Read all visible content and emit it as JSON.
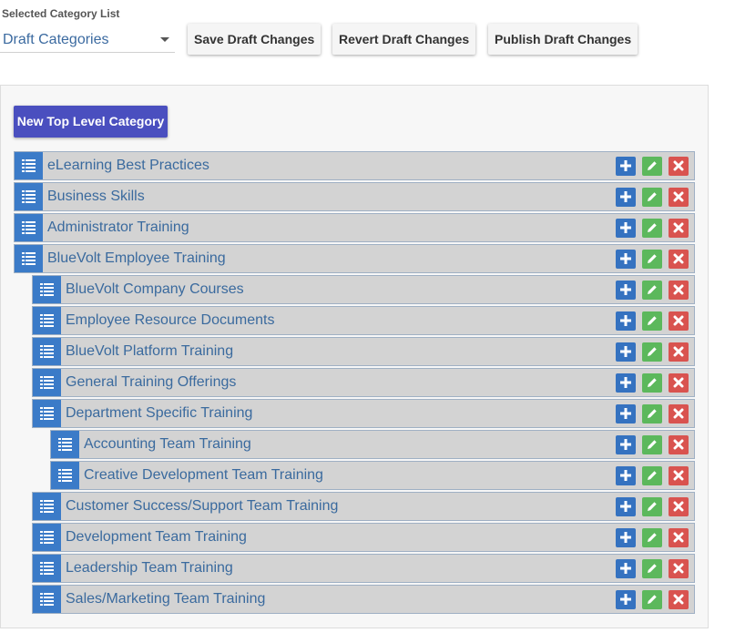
{
  "header": {
    "select_label": "Selected Category List",
    "select_value": "Draft Categories",
    "save_label": "Save Draft Changes",
    "revert_label": "Revert Draft Changes",
    "publish_label": "Publish Draft Changes"
  },
  "panel": {
    "new_top_label": "New Top Level Category"
  },
  "colors": {
    "handle": "#3b7bc8",
    "add": "#3572c0",
    "edit": "#5cb85c",
    "delete": "#d9534f",
    "new_button": "#4a4fbf",
    "row_text": "#3a6a9e"
  },
  "icons": {
    "handle": "list-icon",
    "add": "plus-icon",
    "edit": "pencil-icon",
    "delete": "x-icon",
    "caret": "caret-down-icon"
  },
  "categories": [
    {
      "label": "eLearning Best Practices",
      "level": 0
    },
    {
      "label": "Business Skills",
      "level": 0
    },
    {
      "label": "Administrator Training",
      "level": 0
    },
    {
      "label": "BlueVolt Employee Training",
      "level": 0
    },
    {
      "label": "BlueVolt Company Courses",
      "level": 1
    },
    {
      "label": "Employee Resource Documents",
      "level": 1
    },
    {
      "label": "BlueVolt Platform Training",
      "level": 1
    },
    {
      "label": "General Training Offerings",
      "level": 1
    },
    {
      "label": "Department Specific Training",
      "level": 1
    },
    {
      "label": "Accounting Team Training",
      "level": 2
    },
    {
      "label": "Creative Development Team Training",
      "level": 2
    },
    {
      "label": "Customer Success/Support Team Training",
      "level": 1
    },
    {
      "label": "Development Team Training",
      "level": 1
    },
    {
      "label": "Leadership Team Training",
      "level": 1
    },
    {
      "label": "Sales/Marketing Team Training",
      "level": 1
    }
  ]
}
